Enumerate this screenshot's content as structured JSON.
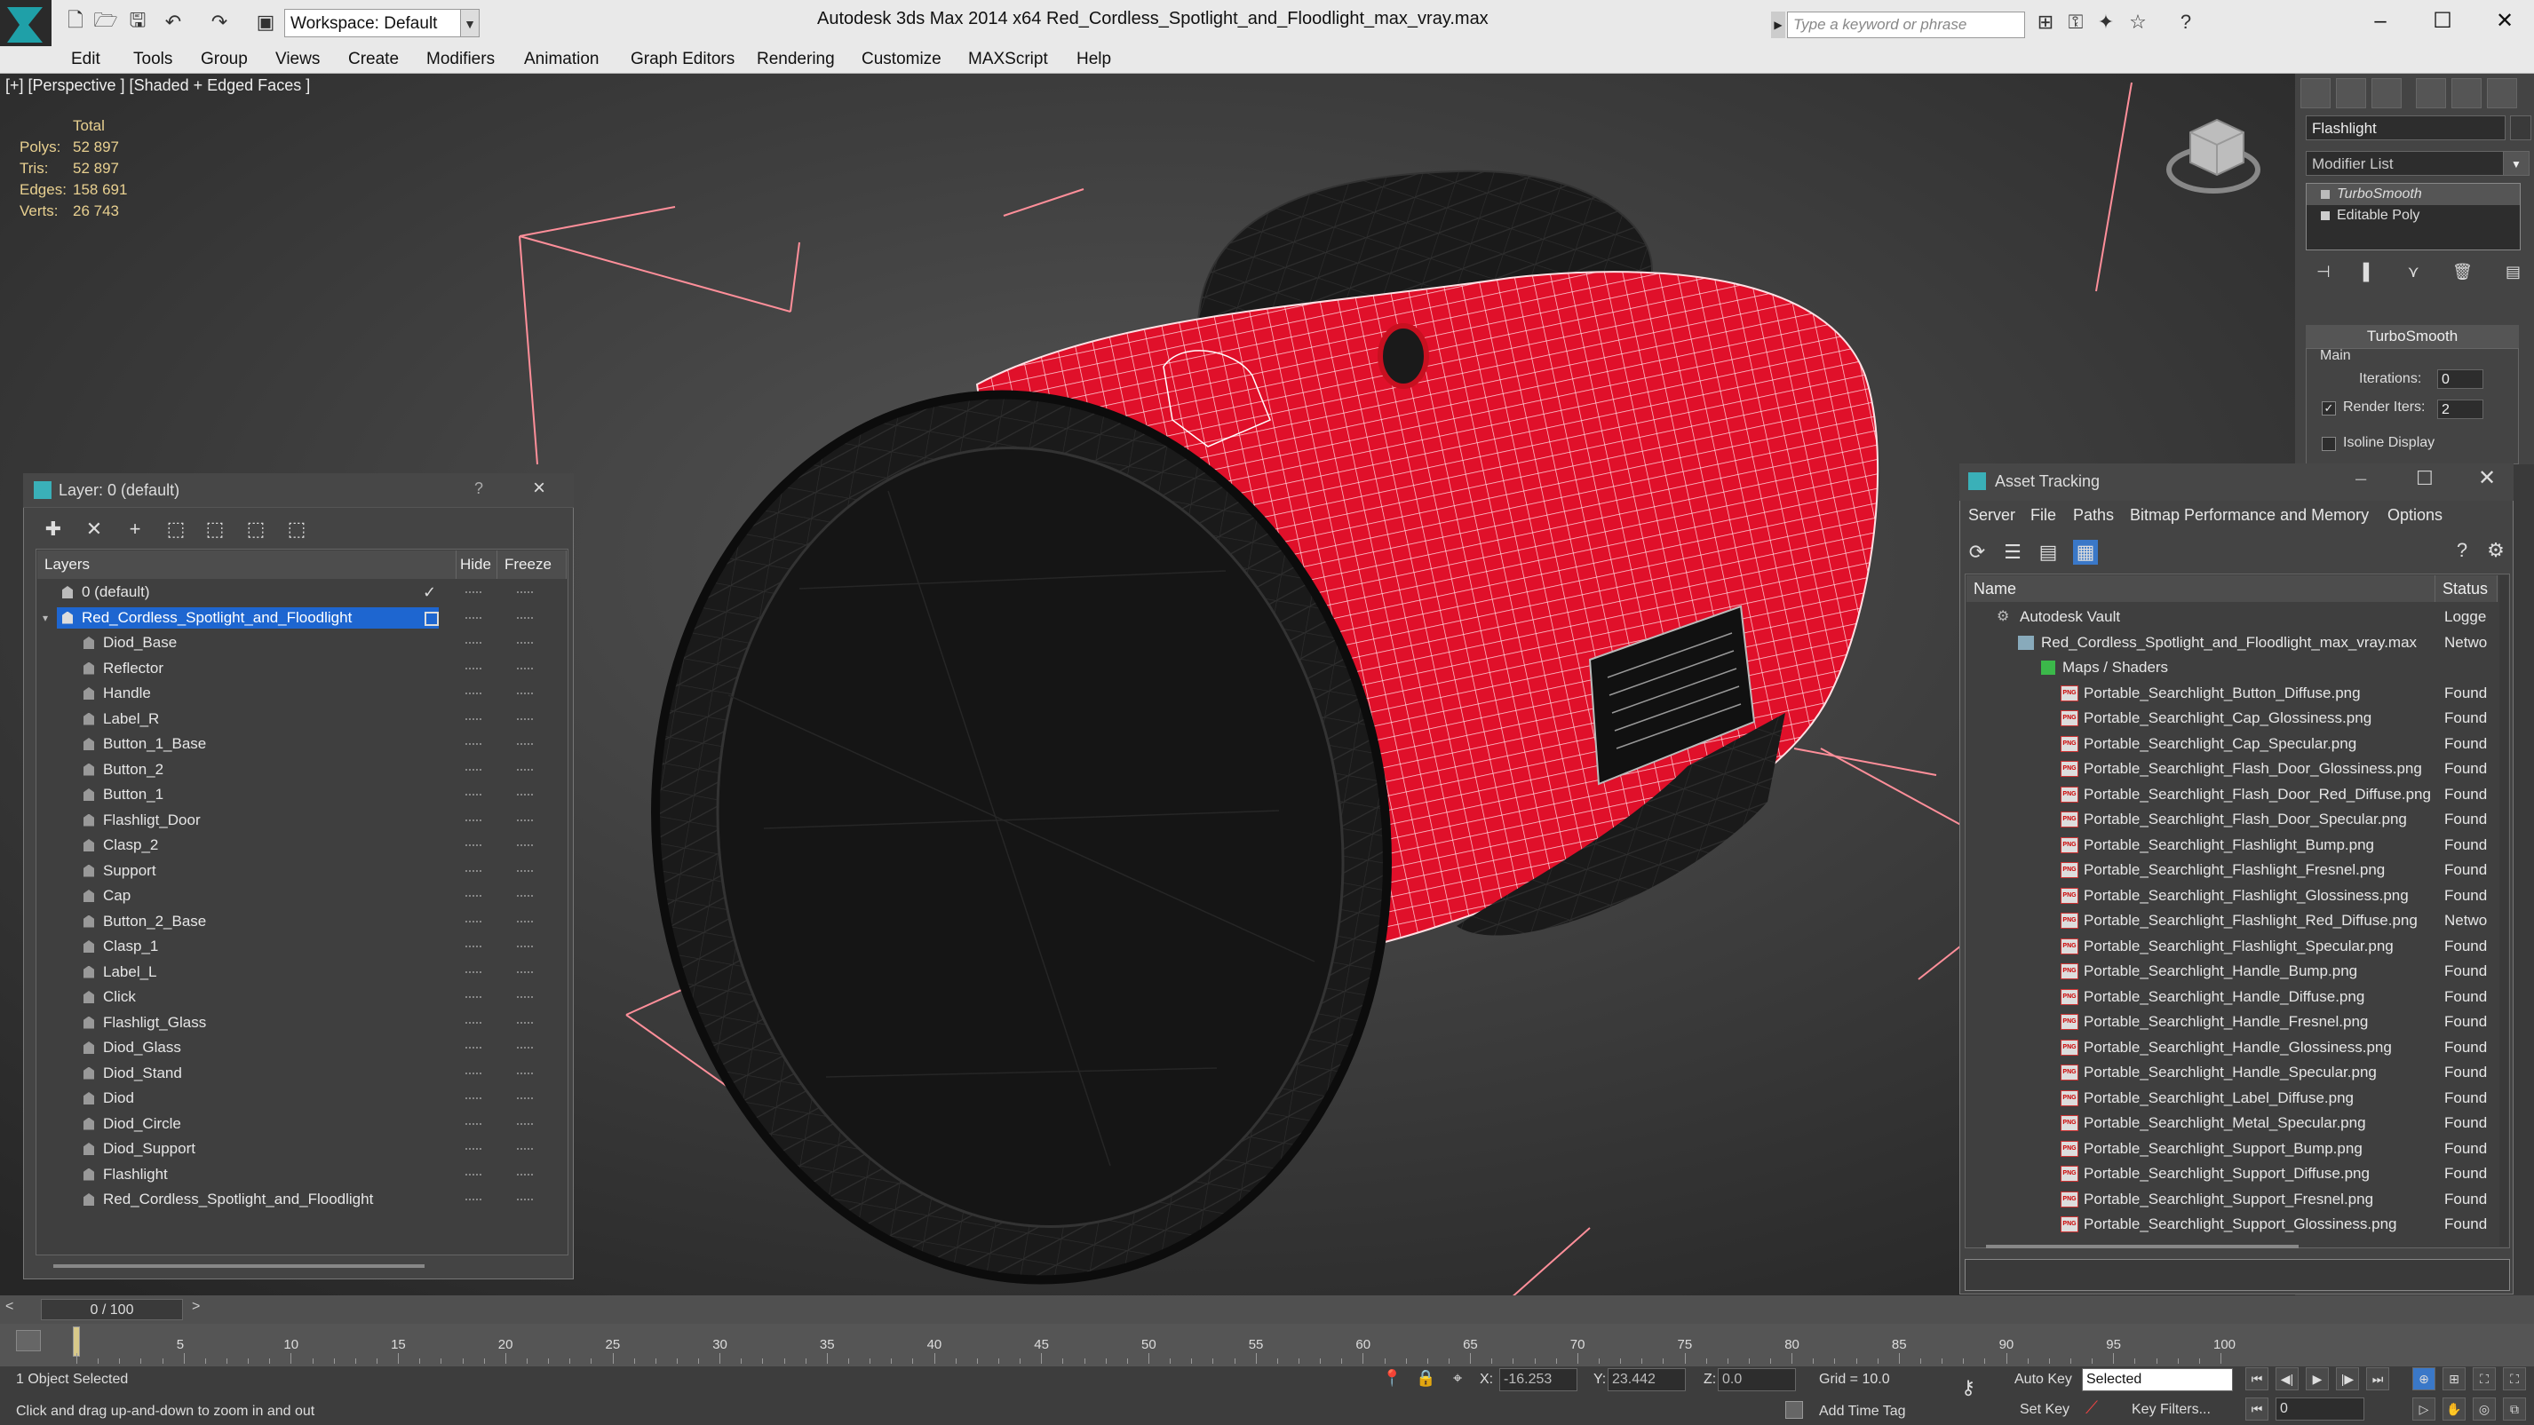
{
  "app": {
    "title": "Autodesk 3ds Max  2014 x64",
    "file": "Red_Cordless_Spotlight_and_Floodlight_max_vray.max",
    "workspace": "Workspace: Default",
    "search_placeholder": "Type a keyword or phrase"
  },
  "menu": [
    "Edit",
    "Tools",
    "Group",
    "Views",
    "Create",
    "Modifiers",
    "Animation",
    "Graph Editors",
    "Rendering",
    "Customize",
    "MAXScript",
    "Help"
  ],
  "viewport": {
    "label": "[+] [Perspective ] [Shaded + Edged Faces ]",
    "stats": {
      "total_label": "Total",
      "rows": [
        {
          "label": "Polys:",
          "value": "52 897"
        },
        {
          "label": "Tris:",
          "value": "52 897"
        },
        {
          "label": "Edges:",
          "value": "158 691"
        },
        {
          "label": "Verts:",
          "value": "26 743"
        }
      ]
    }
  },
  "command_panel": {
    "object_name": "Flashlight",
    "modifier_list": "Modifier List",
    "stack": [
      "TurboSmooth",
      "Editable Poly"
    ],
    "rollout_title": "TurboSmooth",
    "group_label": "Main",
    "iterations_label": "Iterations:",
    "iterations_value": "0",
    "render_iters_label": "Render Iters:",
    "render_iters_value": "2",
    "isoline_label": "Isoline Display"
  },
  "layer_dialog": {
    "title": "Layer: 0 (default)",
    "help": "?",
    "close": "×",
    "columns": {
      "layers": "Layers",
      "hide": "Hide",
      "freeze": "Freeze"
    },
    "default_layer": "0 (default)",
    "selected_layer": "Red_Cordless_Spotlight_and_Floodlight",
    "objects": [
      "Diod_Base",
      "Reflector",
      "Handle",
      "Label_R",
      "Button_1_Base",
      "Button_2",
      "Button_1",
      "Flashligt_Door",
      "Clasp_2",
      "Support",
      "Cap",
      "Button_2_Base",
      "Clasp_1",
      "Label_L",
      "Click",
      "Flashligt_Glass",
      "Diod_Glass",
      "Diod_Stand",
      "Diod",
      "Diod_Circle",
      "Diod_Support",
      "Flashlight",
      "Red_Cordless_Spotlight_and_Floodlight"
    ]
  },
  "asset_dialog": {
    "title": "Asset Tracking",
    "menu": [
      "Server",
      "File",
      "Paths",
      "Bitmap Performance and Memory",
      "Options"
    ],
    "columns": {
      "name": "Name",
      "status": "Status"
    },
    "vault": {
      "name": "Autodesk Vault",
      "status": "Logge"
    },
    "file": {
      "name": "Red_Cordless_Spotlight_and_Floodlight_max_vray.max",
      "status": "Netwo"
    },
    "maps_label": "Maps / Shaders",
    "png_tag": "PNG",
    "maps": [
      {
        "name": "Portable_Searchlight_Button_Diffuse.png",
        "status": "Found"
      },
      {
        "name": "Portable_Searchlight_Cap_Glossiness.png",
        "status": "Found"
      },
      {
        "name": "Portable_Searchlight_Cap_Specular.png",
        "status": "Found"
      },
      {
        "name": "Portable_Searchlight_Flash_Door_Glossiness.png",
        "status": "Found"
      },
      {
        "name": "Portable_Searchlight_Flash_Door_Red_Diffuse.png",
        "status": "Found"
      },
      {
        "name": "Portable_Searchlight_Flash_Door_Specular.png",
        "status": "Found"
      },
      {
        "name": "Portable_Searchlight_Flashlight_Bump.png",
        "status": "Found"
      },
      {
        "name": "Portable_Searchlight_Flashlight_Fresnel.png",
        "status": "Found"
      },
      {
        "name": "Portable_Searchlight_Flashlight_Glossiness.png",
        "status": "Found"
      },
      {
        "name": "Portable_Searchlight_Flashlight_Red_Diffuse.png",
        "status": "Netwo"
      },
      {
        "name": "Portable_Searchlight_Flashlight_Specular.png",
        "status": "Found"
      },
      {
        "name": "Portable_Searchlight_Handle_Bump.png",
        "status": "Found"
      },
      {
        "name": "Portable_Searchlight_Handle_Diffuse.png",
        "status": "Found"
      },
      {
        "name": "Portable_Searchlight_Handle_Fresnel.png",
        "status": "Found"
      },
      {
        "name": "Portable_Searchlight_Handle_Glossiness.png",
        "status": "Found"
      },
      {
        "name": "Portable_Searchlight_Handle_Specular.png",
        "status": "Found"
      },
      {
        "name": "Portable_Searchlight_Label_Diffuse.png",
        "status": "Found"
      },
      {
        "name": "Portable_Searchlight_Metal_Specular.png",
        "status": "Found"
      },
      {
        "name": "Portable_Searchlight_Support_Bump.png",
        "status": "Found"
      },
      {
        "name": "Portable_Searchlight_Support_Diffuse.png",
        "status": "Found"
      },
      {
        "name": "Portable_Searchlight_Support_Fresnel.png",
        "status": "Found"
      },
      {
        "name": "Portable_Searchlight_Support_Glossiness.png",
        "status": "Found"
      }
    ]
  },
  "timeline": {
    "slider": "0 / 100",
    "ticks": [
      5,
      10,
      15,
      20,
      25,
      30,
      35,
      40,
      45,
      50,
      55,
      60,
      65,
      70,
      75,
      80,
      85,
      90,
      95,
      100
    ]
  },
  "status": {
    "selection": "1 Object Selected",
    "prompt": "Click and drag up-and-down to zoom in and out",
    "x_label": "X:",
    "x": "-16.253",
    "y_label": "Y:",
    "y": "23.442",
    "z_label": "Z:",
    "z": "0.0",
    "grid": "Grid = 10.0",
    "auto_key": "Auto Key",
    "set_key": "Set Key",
    "selected": "Selected",
    "key_filters": "Key Filters...",
    "add_time_tag": "Add Time Tag",
    "frame": "0"
  },
  "colors": {
    "model_red": "#e0102a",
    "wire": "#ffffff",
    "selection_blue": "#1e66d0",
    "viewport_bg": "#4a4a4a"
  }
}
